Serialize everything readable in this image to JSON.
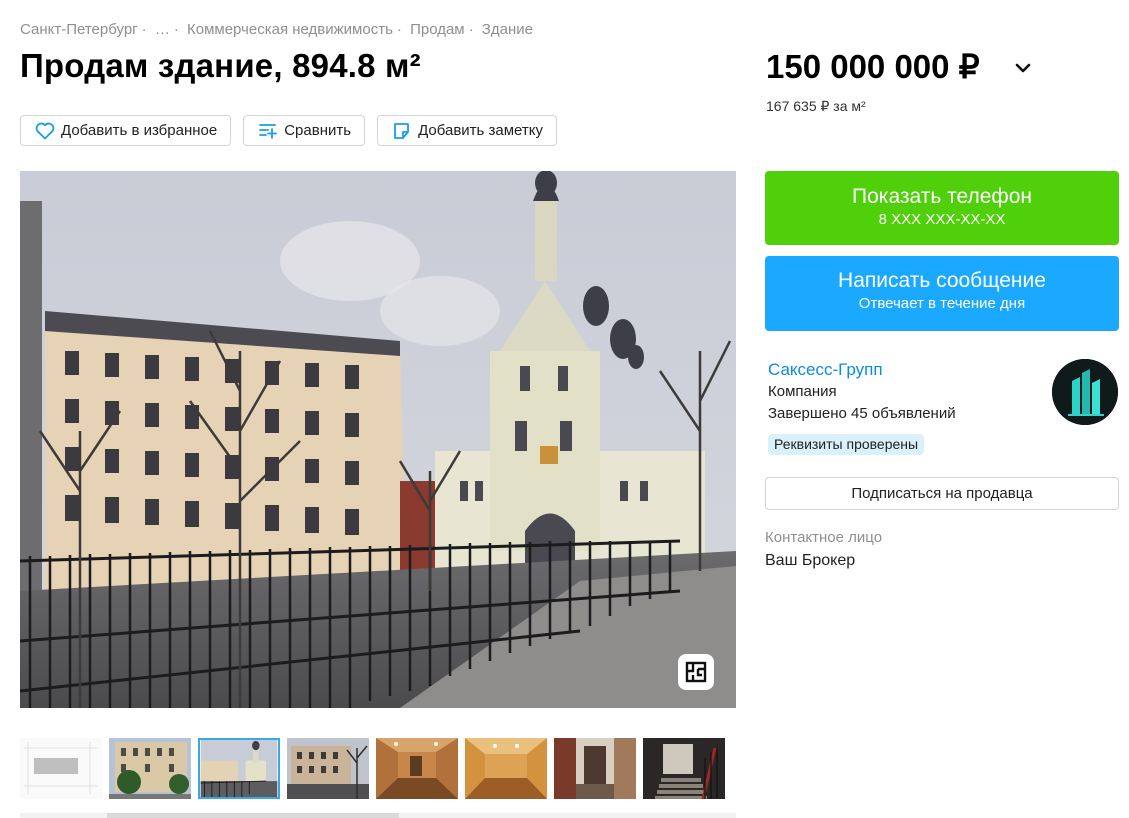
{
  "breadcrumb": {
    "items": [
      "Санкт-Петербург",
      "…",
      "Коммерческая недвижимость",
      "Продам",
      "Здание"
    ],
    "separator": "·"
  },
  "listing": {
    "title": "Продам здание, 894.8 м²",
    "price": "150 000 000 ₽",
    "price_per_m": "167 635 ₽ за м²"
  },
  "actions": {
    "favorite": "Добавить в избранное",
    "compare": "Сравнить",
    "note": "Добавить заметку"
  },
  "gallery": {
    "main_icon": "floor-plan-icon",
    "thumbnails": [
      {
        "name": "thumb-plan",
        "active": false
      },
      {
        "name": "thumb-building-front",
        "active": false
      },
      {
        "name": "thumb-church-street",
        "active": true
      },
      {
        "name": "thumb-courtyard",
        "active": false
      },
      {
        "name": "thumb-interior-room",
        "active": false
      },
      {
        "name": "thumb-interior-room-2",
        "active": false
      },
      {
        "name": "thumb-interior-doorway",
        "active": false
      },
      {
        "name": "thumb-staircase",
        "active": false
      }
    ]
  },
  "contact": {
    "phone_button": "Показать телефон",
    "phone_masked": "8 XXX XXX-XX-XX",
    "message_button": "Написать сообщение",
    "message_sub": "Отвечает в течение дня"
  },
  "seller": {
    "name": "Саксесс-Групп",
    "type": "Компания",
    "completed": "Завершено 45 объявлений",
    "badge": "Реквизиты проверены",
    "subscribe": "Подписаться на продавца",
    "contact_label": "Контактное лицо",
    "contact_name": "Ваш Брокер"
  },
  "colors": {
    "phone_button": "#4fd00b",
    "message_button": "#1aa9ff",
    "seller_link": "#0c8be0",
    "verified_badge_bg": "#daf0fb",
    "active_thumb_border": "#3aa7e6"
  }
}
